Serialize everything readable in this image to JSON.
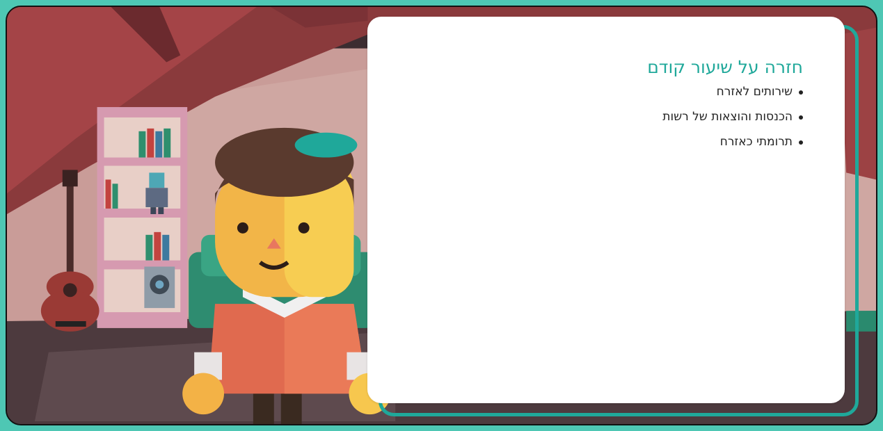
{
  "lesson_card": {
    "title": "חזרה על שיעור קודם",
    "bullets": [
      "שירותים לאזרח",
      "הכנסות והוצאות של רשות",
      "תרומתי כאזרח"
    ]
  },
  "scene": {
    "illustration": "attic-room-with-boy-character",
    "icons": [
      "guitar-icon",
      "bookshelf-icon",
      "robot-toy-icon",
      "speaker-icon",
      "armchair-icon"
    ]
  },
  "colors": {
    "accent": "#1fa89a",
    "background_outer": "#4ec7b4",
    "card_bg": "#ffffff",
    "wall": "#c79a96",
    "ceiling": "#8e3c3c"
  }
}
